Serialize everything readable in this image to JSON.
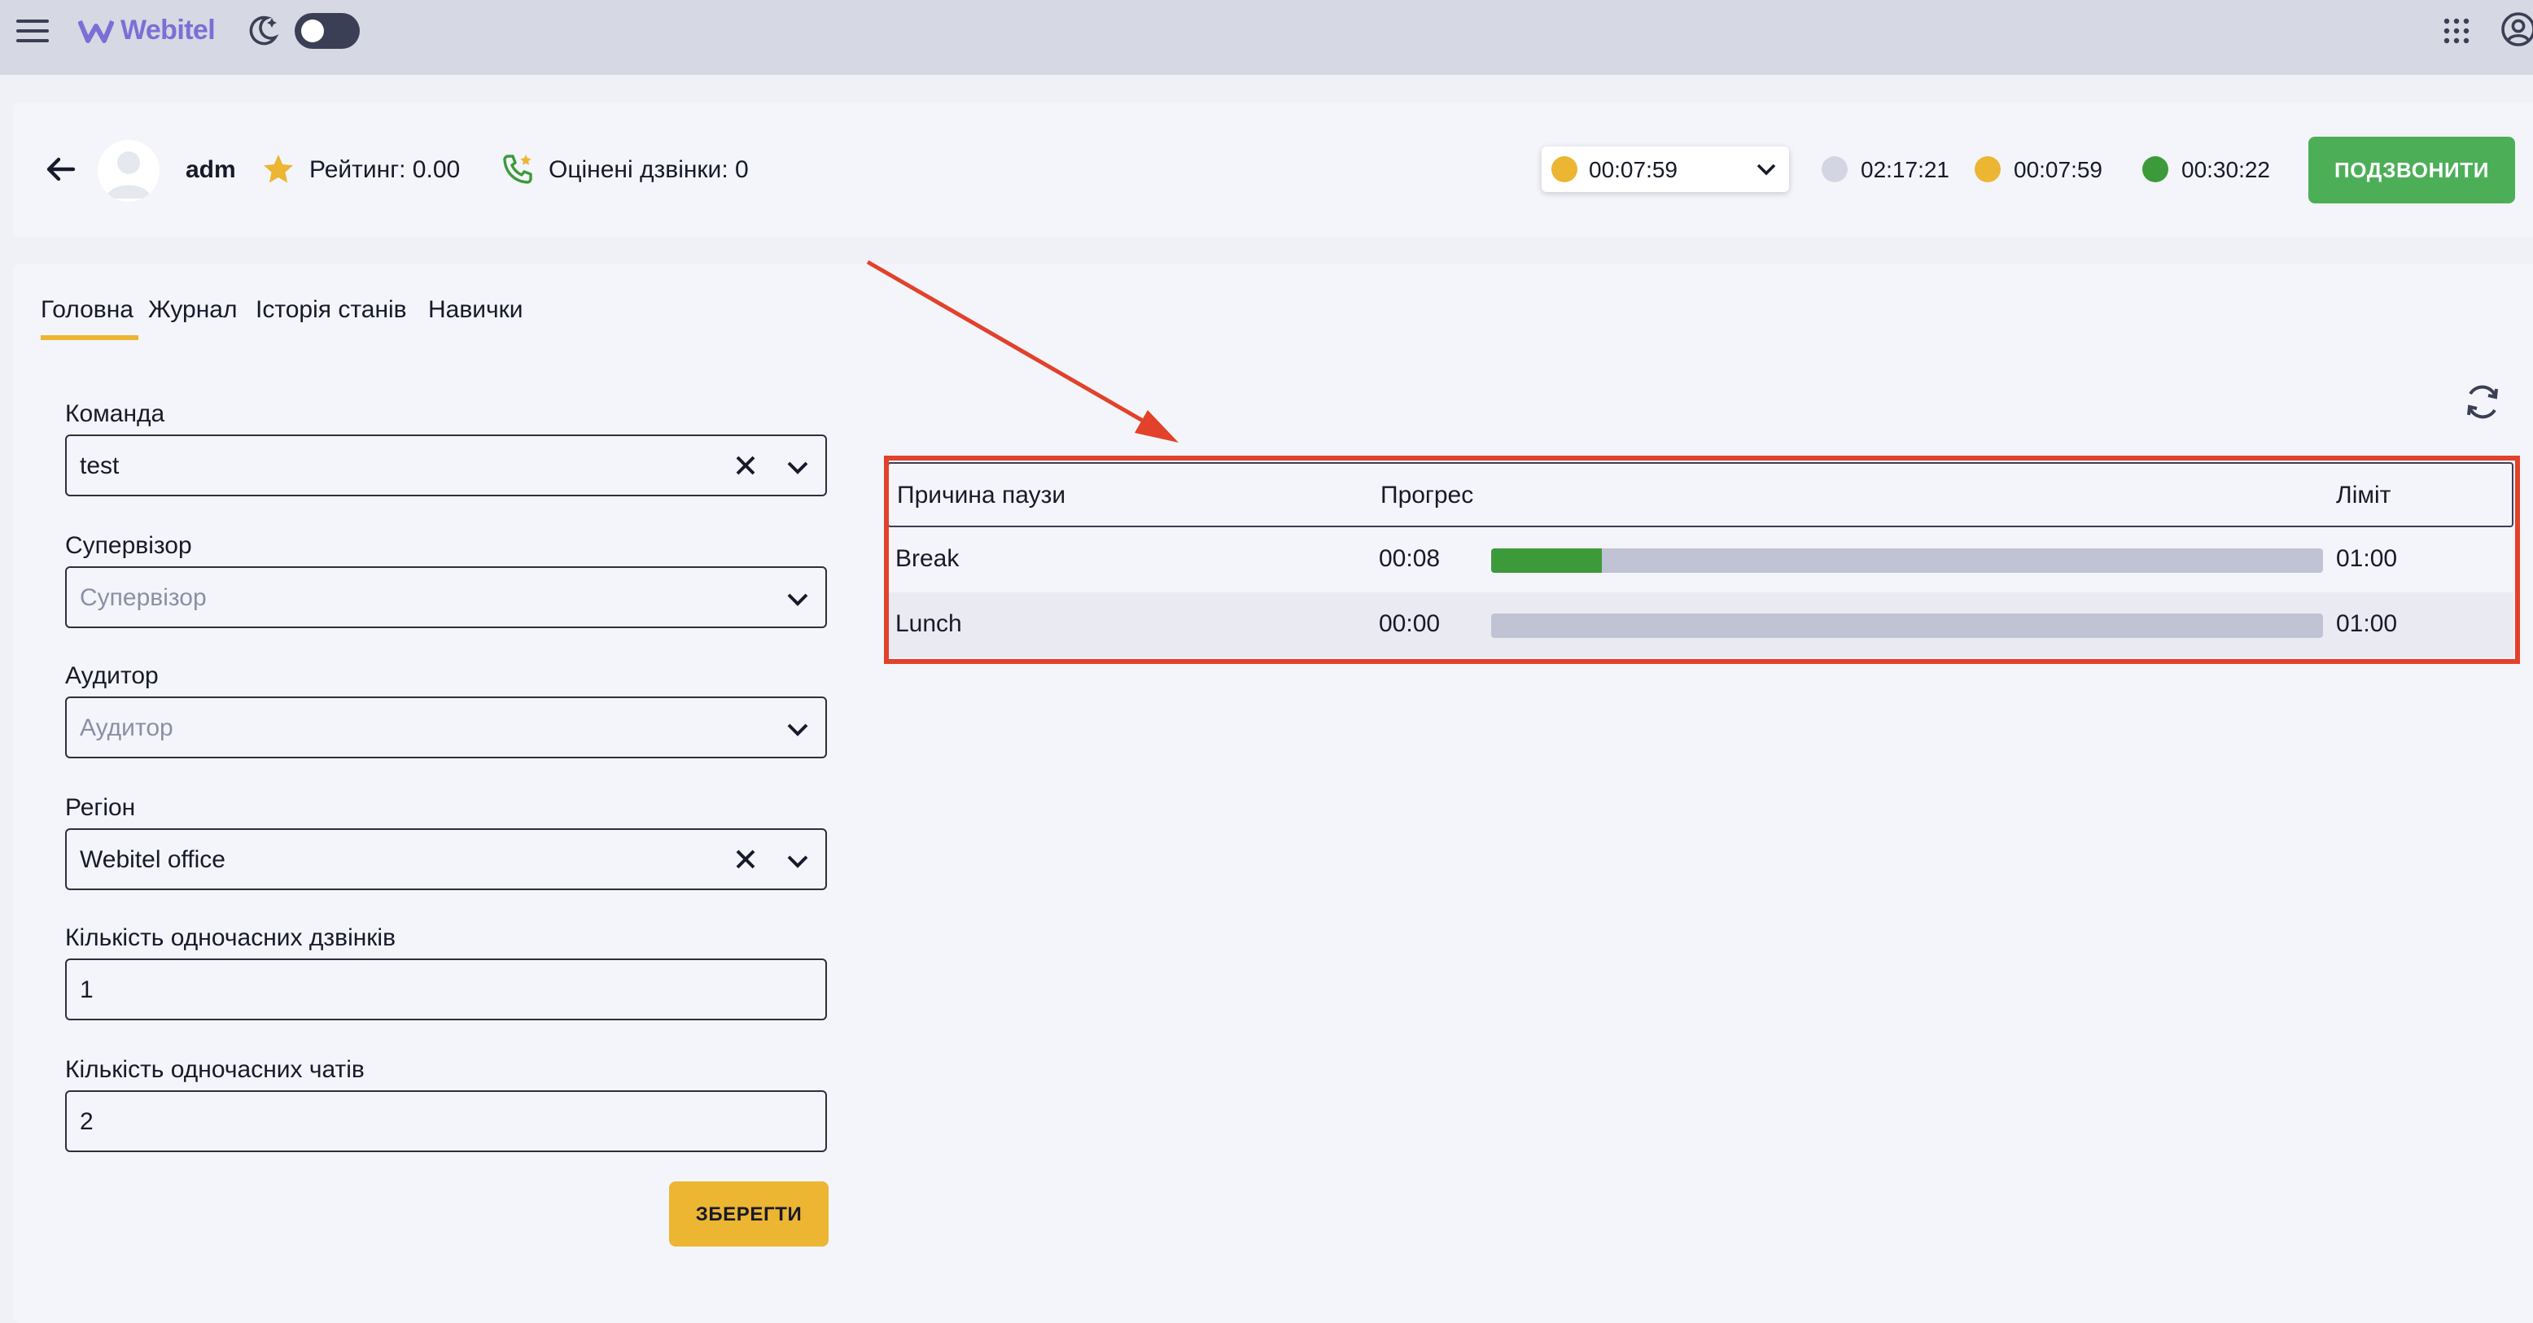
{
  "topbar": {
    "logo_text": "Webitel",
    "theme_toggle": "off"
  },
  "agent": {
    "name": "adm",
    "rating_label": "Рейтинг: 0.00",
    "rated_calls_label": "Оцінені дзвінки: 0"
  },
  "status": {
    "selected_value": "00:07:59",
    "selected_color": "#ecb532",
    "timers": [
      {
        "value": "02:17:21",
        "color": "#d3d6e2"
      },
      {
        "value": "00:07:59",
        "color": "#ecb532"
      },
      {
        "value": "00:30:22",
        "color": "#3d9a3a"
      }
    ],
    "call_button": "ПОДЗВОНИТИ"
  },
  "tabs": [
    {
      "label": "Головна",
      "active": true
    },
    {
      "label": "Журнал",
      "active": false
    },
    {
      "label": "Історія станів",
      "active": false
    },
    {
      "label": "Навички",
      "active": false
    }
  ],
  "form": {
    "team": {
      "label": "Команда",
      "value": "test"
    },
    "supervisor": {
      "label": "Супервізор",
      "placeholder": "Супервізор"
    },
    "auditor": {
      "label": "Аудитор",
      "placeholder": "Аудитор"
    },
    "region": {
      "label": "Регіон",
      "value": "Webitel office"
    },
    "calls": {
      "label": "Кількість одночасних дзвінків",
      "value": "1"
    },
    "chats": {
      "label": "Кількість одночасних чатів",
      "value": "2"
    },
    "save_button": "ЗБЕРЕГТИ"
  },
  "pause_table": {
    "headers": {
      "reason": "Причина паузи",
      "progress": "Прогрес",
      "limit": "Ліміт"
    },
    "rows": [
      {
        "reason": "Break",
        "time": "00:08",
        "limit": "01:00",
        "progress_fraction": 0.133
      },
      {
        "reason": "Lunch",
        "time": "00:00",
        "limit": "01:00",
        "progress_fraction": 0.0
      }
    ]
  },
  "colors": {
    "accent_yellow": "#ecb532",
    "call_green": "#4caf58",
    "progress_green": "#3d9a3a",
    "annotation_red": "#e2412b"
  }
}
